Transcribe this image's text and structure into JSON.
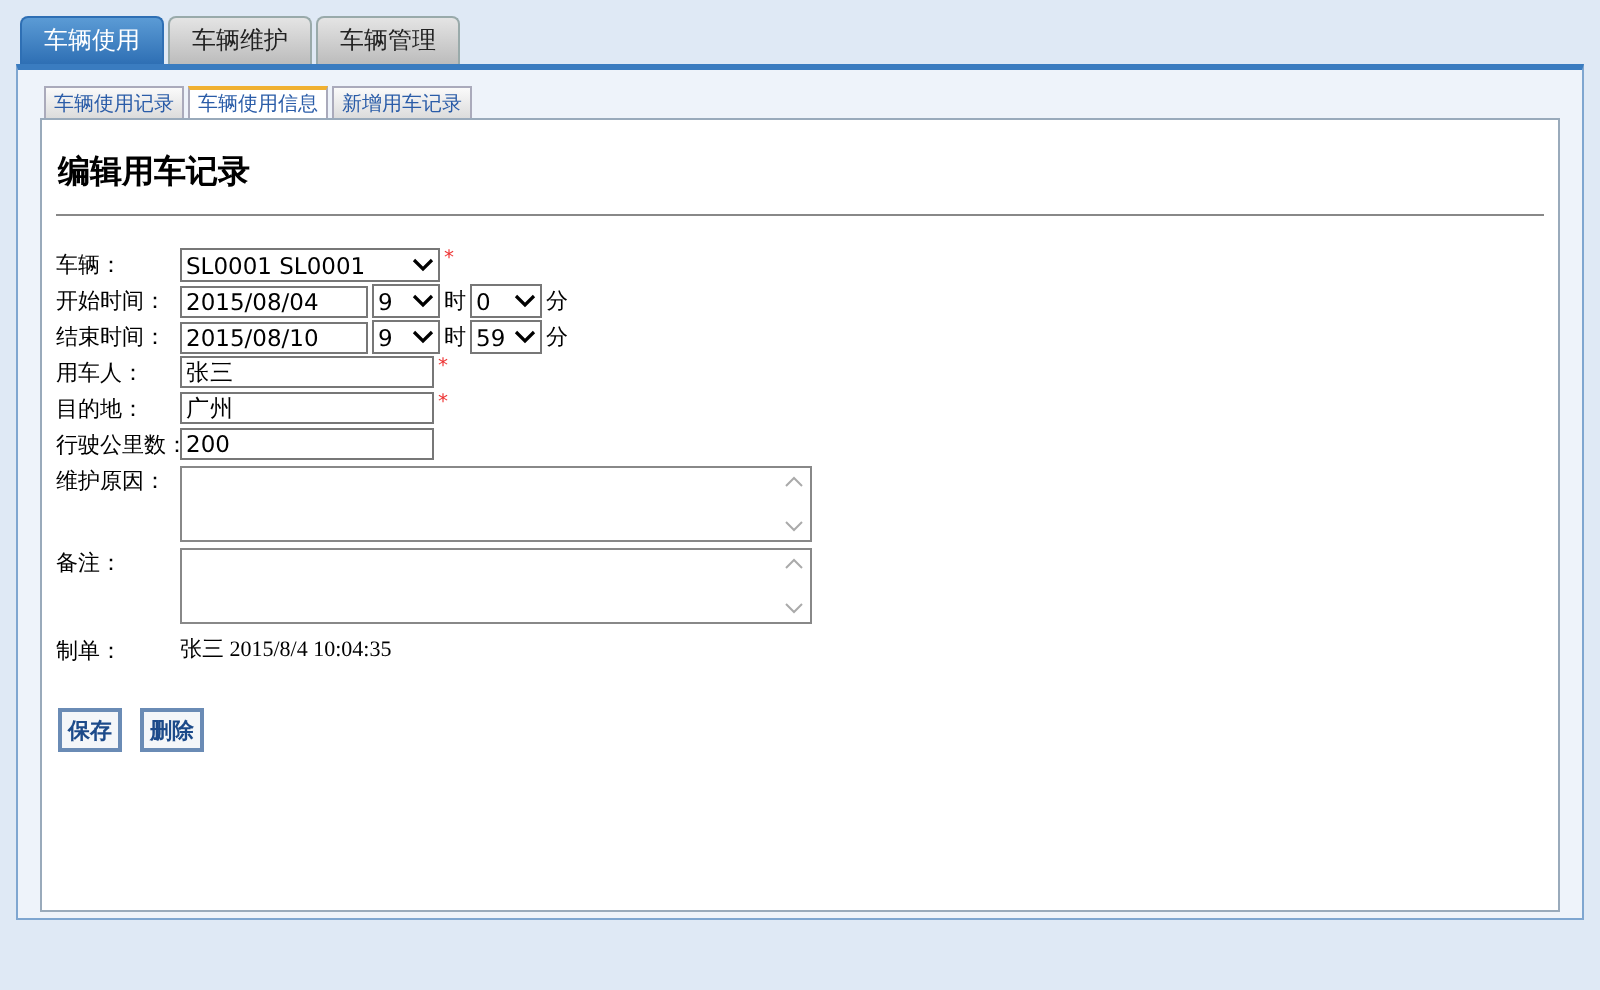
{
  "main_tabs": [
    {
      "label": "车辆使用",
      "selected": true
    },
    {
      "label": "车辆维护",
      "selected": false
    },
    {
      "label": "车辆管理",
      "selected": false
    }
  ],
  "sub_tabs": [
    {
      "label": "车辆使用记录",
      "selected": false
    },
    {
      "label": "车辆使用信息",
      "selected": true
    },
    {
      "label": "新增用车记录",
      "selected": false
    }
  ],
  "heading": "编辑用车记录",
  "fields": [
    {
      "kind": "select",
      "label": "车辆：",
      "value": "SL0001 SL0001",
      "required_mark": "*"
    },
    {
      "kind": "datetime",
      "label": "开始时间：",
      "date": "2015/08/04",
      "hour": "9",
      "hour_unit": "时",
      "minute": "0",
      "minute_unit": "分"
    },
    {
      "kind": "datetime",
      "label": "结束时间：",
      "date": "2015/08/10",
      "hour": "9",
      "hour_unit": "时",
      "minute": "59",
      "minute_unit": "分"
    },
    {
      "kind": "text",
      "label": "用车人：",
      "value": "张三",
      "required_mark": "*"
    },
    {
      "kind": "text",
      "label": "目的地：",
      "value": "广州",
      "required_mark": "*"
    },
    {
      "kind": "text",
      "label": "行驶公里数：",
      "value": "200"
    },
    {
      "kind": "textarea",
      "label": "维护原因："
    },
    {
      "kind": "textarea",
      "label": "备注："
    },
    {
      "kind": "static",
      "label": "制单：",
      "value": "张三 2015/8/4 10:04:35"
    }
  ],
  "buttons": [
    "保存",
    "删除"
  ]
}
